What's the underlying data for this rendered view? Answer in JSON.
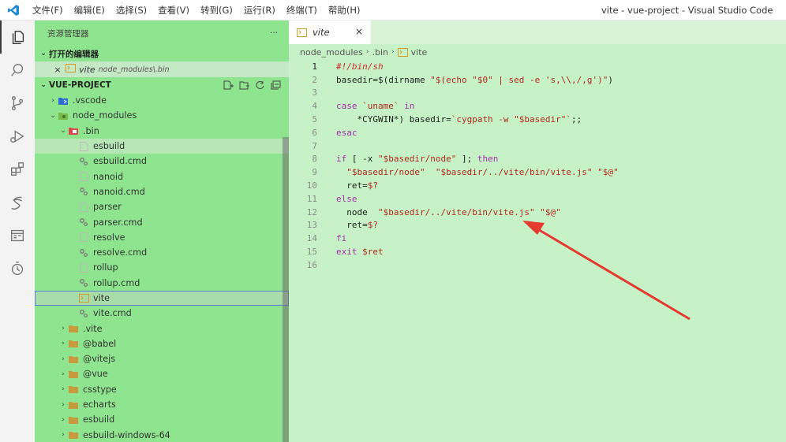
{
  "titlebar": {
    "menu": [
      "文件(F)",
      "编辑(E)",
      "选择(S)",
      "查看(V)",
      "转到(G)",
      "运行(R)",
      "终端(T)",
      "帮助(H)"
    ],
    "window_title": "vite - vue-project - Visual Studio Code"
  },
  "activitybar": {
    "icons": [
      "explorer-icon",
      "search-icon",
      "source-control-icon",
      "run-debug-icon",
      "extensions-icon",
      "custom-s-icon",
      "panel-icon",
      "timeline-icon"
    ]
  },
  "sidebar": {
    "title": "资源管理器",
    "more": "···",
    "open_editors": {
      "label": "打开的编辑器",
      "items": [
        {
          "name": "vite",
          "path": "node_modules\\.bin"
        }
      ]
    },
    "project": {
      "label": "VUE-PROJECT",
      "rows": [
        {
          "label": ".vscode",
          "type": "folder-vscode",
          "depth": 1,
          "chev": "›"
        },
        {
          "label": "node_modules",
          "type": "folder-node",
          "depth": 1,
          "chev": "⌄"
        },
        {
          "label": ".bin",
          "type": "folder-bin",
          "depth": 2,
          "chev": "⌄"
        },
        {
          "label": "esbuild",
          "type": "file",
          "depth": 3,
          "chev": ""
        },
        {
          "label": "esbuild.cmd",
          "type": "cmd",
          "depth": 3,
          "chev": ""
        },
        {
          "label": "nanoid",
          "type": "file",
          "depth": 3,
          "chev": ""
        },
        {
          "label": "nanoid.cmd",
          "type": "cmd",
          "depth": 3,
          "chev": ""
        },
        {
          "label": "parser",
          "type": "file",
          "depth": 3,
          "chev": ""
        },
        {
          "label": "parser.cmd",
          "type": "cmd",
          "depth": 3,
          "chev": ""
        },
        {
          "label": "resolve",
          "type": "file",
          "depth": 3,
          "chev": ""
        },
        {
          "label": "resolve.cmd",
          "type": "cmd",
          "depth": 3,
          "chev": ""
        },
        {
          "label": "rollup",
          "type": "file",
          "depth": 3,
          "chev": ""
        },
        {
          "label": "rollup.cmd",
          "type": "cmd",
          "depth": 3,
          "chev": ""
        },
        {
          "label": "vite",
          "type": "shell",
          "depth": 3,
          "chev": ""
        },
        {
          "label": "vite.cmd",
          "type": "cmd",
          "depth": 3,
          "chev": ""
        },
        {
          "label": ".vite",
          "type": "folder",
          "depth": 2,
          "chev": "›"
        },
        {
          "label": "@babel",
          "type": "folder",
          "depth": 2,
          "chev": "›"
        },
        {
          "label": "@vitejs",
          "type": "folder",
          "depth": 2,
          "chev": "›"
        },
        {
          "label": "@vue",
          "type": "folder",
          "depth": 2,
          "chev": "›"
        },
        {
          "label": "csstype",
          "type": "folder",
          "depth": 2,
          "chev": "›"
        },
        {
          "label": "echarts",
          "type": "folder",
          "depth": 2,
          "chev": "›"
        },
        {
          "label": "esbuild",
          "type": "folder",
          "depth": 2,
          "chev": "›"
        },
        {
          "label": "esbuild-windows-64",
          "type": "folder",
          "depth": 2,
          "chev": "›"
        }
      ],
      "selected": "vite"
    }
  },
  "editor": {
    "tab": {
      "label": "vite",
      "close": "×"
    },
    "breadcrumb": [
      "node_modules",
      ".bin",
      "vite"
    ],
    "lines": [
      {
        "n": "1",
        "tokens": [
          [
            "cm",
            "#!/bin/sh"
          ]
        ]
      },
      {
        "n": "2",
        "tokens": [
          [
            "pl",
            "basedir=$(dirname "
          ],
          [
            "str",
            "\"$(echo \"$0\" | sed -e 's,\\\\,/,g')\""
          ],
          [
            "pl",
            ")"
          ]
        ]
      },
      {
        "n": "3",
        "tokens": []
      },
      {
        "n": "4",
        "tokens": [
          [
            "kw",
            "case"
          ],
          [
            "pl",
            " "
          ],
          [
            "str",
            "`uname`"
          ],
          [
            "pl",
            " "
          ],
          [
            "kw",
            "in"
          ]
        ]
      },
      {
        "n": "5",
        "tokens": [
          [
            "pl",
            "    *CYGWIN*) basedir="
          ],
          [
            "str",
            "`cygpath -w \"$basedir\"`"
          ],
          [
            "pl",
            ";;"
          ]
        ]
      },
      {
        "n": "6",
        "tokens": [
          [
            "kw",
            "esac"
          ]
        ]
      },
      {
        "n": "7",
        "tokens": []
      },
      {
        "n": "8",
        "tokens": [
          [
            "kw",
            "if"
          ],
          [
            "pl",
            " [ -x "
          ],
          [
            "str",
            "\"$basedir/node\""
          ],
          [
            "pl",
            " ]; "
          ],
          [
            "kw",
            "then"
          ]
        ]
      },
      {
        "n": "9",
        "tokens": [
          [
            "pl",
            "  "
          ],
          [
            "str",
            "\"$basedir/node\""
          ],
          [
            "pl",
            "  "
          ],
          [
            "str",
            "\"$basedir/../vite/bin/vite.js\""
          ],
          [
            "pl",
            " "
          ],
          [
            "str",
            "\"$@\""
          ]
        ]
      },
      {
        "n": "10",
        "tokens": [
          [
            "pl",
            "  ret="
          ],
          [
            "str",
            "$?"
          ]
        ]
      },
      {
        "n": "11",
        "tokens": [
          [
            "kw",
            "else"
          ]
        ]
      },
      {
        "n": "12",
        "tokens": [
          [
            "pl",
            "  node  "
          ],
          [
            "str",
            "\"$basedir/../vite/bin/vite.js\""
          ],
          [
            "pl",
            " "
          ],
          [
            "str",
            "\"$@\""
          ]
        ]
      },
      {
        "n": "13",
        "tokens": [
          [
            "pl",
            "  ret="
          ],
          [
            "str",
            "$?"
          ]
        ]
      },
      {
        "n": "14",
        "tokens": [
          [
            "kw",
            "fi"
          ]
        ]
      },
      {
        "n": "15",
        "tokens": [
          [
            "kw",
            "exit"
          ],
          [
            "pl",
            " "
          ],
          [
            "str",
            "$ret"
          ]
        ]
      },
      {
        "n": "16",
        "tokens": []
      }
    ],
    "current_line": "1"
  },
  "colors": {
    "sidebar_bg": "#8fe58f",
    "editor_bg": "#c7f2c7",
    "arrow": "#e53a2f"
  }
}
